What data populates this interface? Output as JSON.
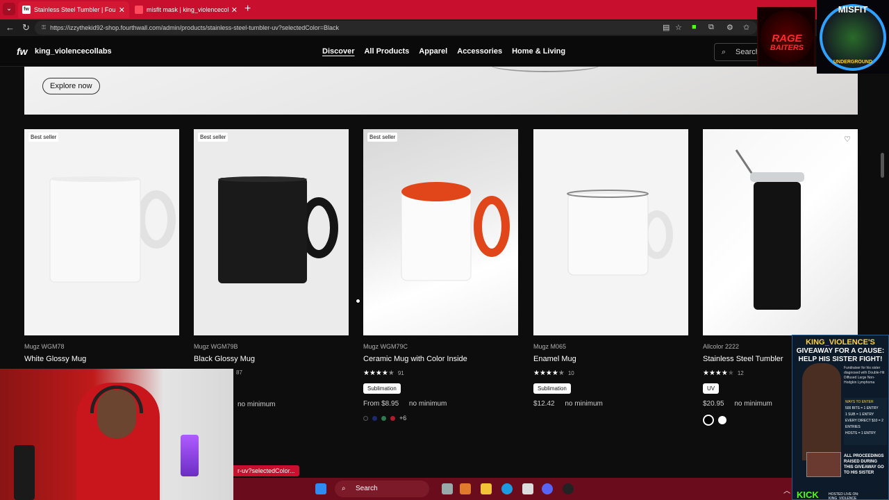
{
  "browser": {
    "tabs": [
      {
        "label": "Stainless Steel Tumbler | Fourthwa",
        "active": true
      },
      {
        "label": "misfit mask | king_violencecollabs",
        "active": false
      }
    ],
    "url": "https://izzythekid92-shop.fourthwall.com/admin/products/stainless-steel-tumbler-uv?selectedColor=Black"
  },
  "site": {
    "logo": "fw",
    "store_name": "king_violencecollabs",
    "nav": [
      "Discover",
      "All Products",
      "Apparel",
      "Accessories",
      "Home & Living"
    ],
    "active_nav": "Discover",
    "search_label": "Search",
    "banner_button": "Explore now"
  },
  "products": [
    {
      "badge": "Best seller",
      "brand": "Mugz WGM78",
      "name": "White Glossy Mug",
      "rating": null,
      "count": "",
      "chip": "",
      "price": "",
      "minimum": ""
    },
    {
      "badge": "Best seller",
      "brand": "Mugz WGM79B",
      "name": "Black Glossy Mug",
      "rating": null,
      "count": "87",
      "chip": "",
      "price": "",
      "minimum": "no minimum"
    },
    {
      "badge": "Best seller",
      "brand": "Mugz WGM79C",
      "name": "Ceramic Mug with Color Inside",
      "rating": 4.5,
      "count": "91",
      "chip": "Sublimation",
      "price": "From $8.95",
      "minimum": "no minimum",
      "swatch_more": "+6",
      "swatch_colors": [
        "#111111",
        "#1e2a6e",
        "#2d7a4f",
        "#b01c2e"
      ]
    },
    {
      "badge": "",
      "brand": "Mugz M065",
      "name": "Enamel Mug",
      "rating": 4.5,
      "count": "10",
      "chip": "Sublimation",
      "price": "$12.42",
      "minimum": "no minimum"
    },
    {
      "badge": "",
      "brand": "Allcolor 2222",
      "name": "Stainless Steel Tumbler",
      "rating": 4,
      "count": "12",
      "chip": "UV",
      "price": "$20.95",
      "minimum": "no minimum",
      "swatch_colors": [
        "#000000",
        "#ffffff"
      ]
    }
  ],
  "overlay": {
    "url_tooltip": "r-uv?selectedColor...",
    "promo": {
      "title": "KING_VIOLENCE'S",
      "headline": "GIVEAWAY FOR A CAUSE: HELP HIS SISTER FIGHT!",
      "sub": "Fundraiser for his sister diagnosed with Double-Hit Diffused Large Non-Hodgkin Lymphoma",
      "ways_title": "WAYS TO ENTER",
      "ways": [
        "500 BITS = 1 ENTRY",
        "1 SUB = 1 ENTRY",
        "EVERY DIRECT $10 = 2 ENTRIES",
        "HOSTS = 1 ENTRY"
      ],
      "raised": "ALL PROCEEDINGS RAISED DURING THIS GIVEAWAY GO TO HIS SISTER",
      "kick": "KICK",
      "kick_sub": "HOSTED LIVE ON: KING_VIOLENCE"
    },
    "logo_rage": [
      "RAGE",
      "BAITERS"
    ],
    "logo_misfit": [
      "MISFIT",
      "UNDERGROUND"
    ]
  },
  "taskbar": {
    "search_label": "Search"
  },
  "colors": {
    "tabbar": "#c8102e",
    "accent_orange": "#e0461a",
    "kick_green": "#53fc18"
  }
}
